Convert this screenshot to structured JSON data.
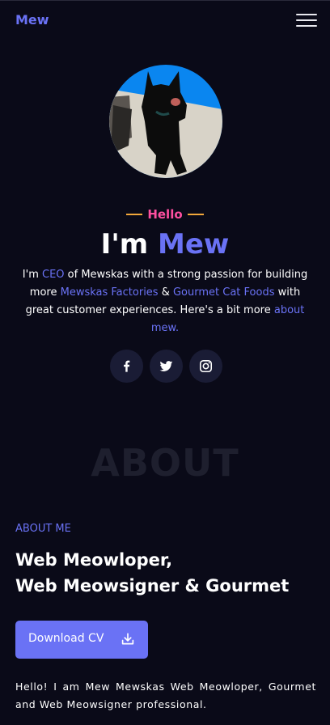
{
  "nav": {
    "brand": "Mew",
    "menu_icon": "hamburger-menu-icon"
  },
  "hero": {
    "avatar_alt": "black cat photo",
    "hello": "Hello",
    "headline_prefix": "I'm",
    "headline_name": "Mew",
    "intro": {
      "p1": "I'm ",
      "l1": "CEO",
      "p2": " of Mewskas with a strong passion for building more ",
      "l2": "Mewskas Factories",
      "p3": " & ",
      "l3": "Gourmet Cat Foods",
      "p4": " with great customer experiences. Here's a bit more ",
      "l4": "about mew."
    },
    "socials": [
      "facebook-icon",
      "twitter-icon",
      "instagram-icon"
    ]
  },
  "about": {
    "watermark": "ABOUT",
    "kicker": "ABOUT ME",
    "role_line1": "Web Meowloper,",
    "role_line2": "Web Meowsigner & Gourmet",
    "download_label": "Download CV",
    "download_icon": "download-icon",
    "bio": "Hello! I am Mew Mewskas Web Meowloper, Gourmet and Web Meowsigner professional."
  },
  "colors": {
    "background": "#0a0a18",
    "accent": "#6a72f5",
    "hello_pink": "#ff4fa0",
    "hello_dash": "#f2a83b",
    "social_bg": "#1a1c35"
  }
}
